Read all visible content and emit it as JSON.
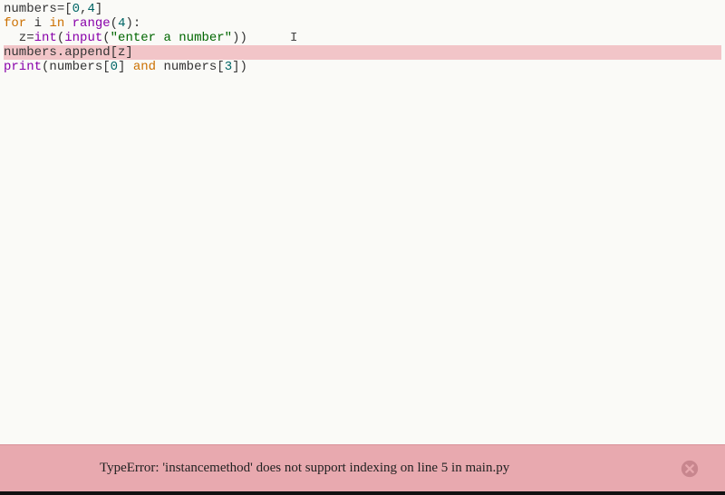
{
  "code": {
    "line1_a": "numbers",
    "line1_b": "=[",
    "line1_c": "0",
    "line1_d": ",",
    "line1_e": "4",
    "line1_f": "]",
    "line2_a": "for",
    "line2_b": " i ",
    "line2_c": "in",
    "line2_d": " ",
    "line2_e": "range",
    "line2_f": "(",
    "line2_g": "4",
    "line2_h": "):",
    "line3_a": "  z=",
    "line3_b": "int",
    "line3_c": "(",
    "line3_d": "input",
    "line3_e": "(",
    "line3_f": "\"enter a number\"",
    "line3_g": "))",
    "line4_a": "numbers.append[z]",
    "line5_a": "print",
    "line5_b": "(numbers[",
    "line5_c": "0",
    "line5_d": "] ",
    "line5_e": "and",
    "line5_f": " numbers[",
    "line5_g": "3",
    "line5_h": "])"
  },
  "cursor_symbol": "I",
  "error": {
    "message": "TypeError: 'instancemethod' does not support indexing on line 5 in main.py"
  }
}
